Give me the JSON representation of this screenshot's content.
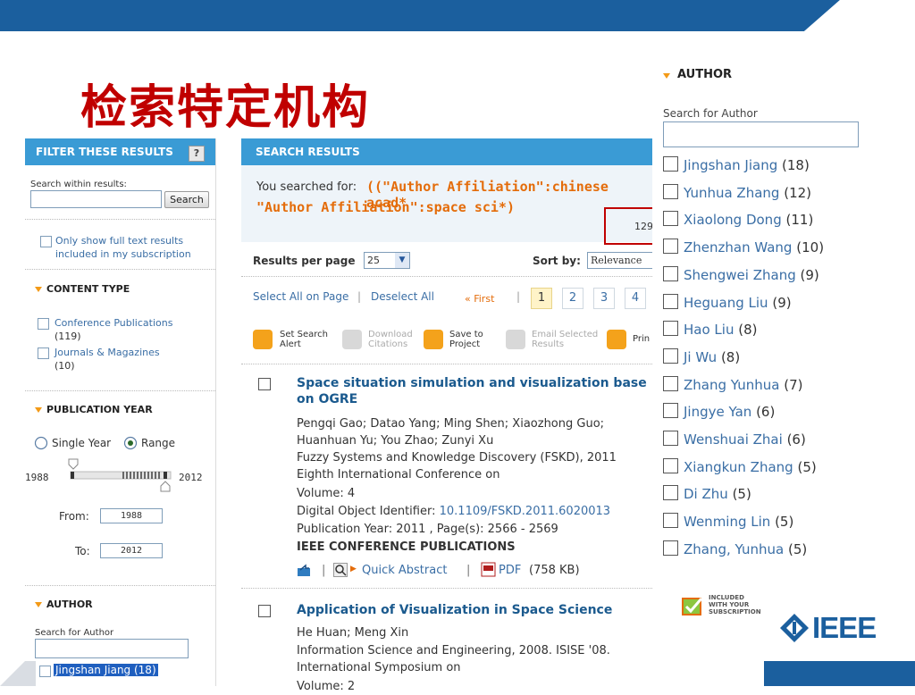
{
  "slide_title": "检索特定机构",
  "colors": {
    "accent_blue": "#1b5f9e",
    "header_blue": "#3a9bd5",
    "title_red": "#c00000",
    "orange": "#e46c0a"
  },
  "filter_panel": {
    "header": "FILTER THESE RESULTS",
    "help_label": "?",
    "search_within_label": "Search within results:",
    "search_button": "Search",
    "full_text_label_1": "Only show full text results",
    "full_text_label_2": "included in my subscription",
    "content_type_title": "CONTENT TYPE",
    "content_types": [
      {
        "label": "Conference Publications",
        "count": "(119)"
      },
      {
        "label": "Journals & Magazines",
        "count": "(10)"
      }
    ],
    "pub_year_title": "PUBLICATION YEAR",
    "single_year_label": "Single Year",
    "range_label": "Range",
    "year_min": "1988",
    "year_max": "2012",
    "from_label": "From:",
    "from_value": "1988",
    "to_label": "To:",
    "to_value": "2012",
    "author_title": "AUTHOR",
    "search_author_label": "Search for Author",
    "first_author": "Jingshan Jiang (18)"
  },
  "results": {
    "header": "SEARCH RESULTS",
    "searched_for_label": "You searched for:",
    "query_line1": "((\"Author Affiliation\":chinese acad*",
    "query_line2": "\"Author Affiliation\":space sci*)",
    "count_partial": "129",
    "per_page_label": "Results per page",
    "per_page_value": "25",
    "sort_label": "Sort by:",
    "sort_value": "Relevance",
    "select_all": "Select All on Page",
    "deselect_all": "Deselect All",
    "first": "« First",
    "pages": [
      "1",
      "2",
      "3",
      "4"
    ],
    "toolbar": {
      "set_alert_1": "Set Search",
      "set_alert_2": "Alert",
      "download_1": "Download",
      "download_2": "Citations",
      "save_1": "Save to",
      "save_2": "Project",
      "email_1": "Email Selected",
      "email_2": "Results",
      "print": "Prin"
    },
    "items": [
      {
        "title_1": "Space situation simulation and visualization base",
        "title_2": "on OGRE",
        "authors_1": "Pengqi Gao; Datao Yang; Ming Shen; Xiaozhong Guo;",
        "authors_2": "Huanhuan Yu; You Zhao; Zunyi Xu",
        "venue_1": "Fuzzy Systems and Knowledge Discovery (FSKD), 2011",
        "venue_2": "Eighth International Conference on",
        "volume": "Volume: 4",
        "doi_label": "Digital Object Identifier:",
        "doi": "10.1109/FSKD.2011.6020013",
        "pubyear": "Publication Year: 2011 , Page(s): 2566 - 2569",
        "publisher": "IEEE CONFERENCE PUBLICATIONS",
        "quick_abstract": "Quick Abstract",
        "pdf_label": "PDF",
        "pdf_size": "(758  KB)"
      },
      {
        "title_1": "Application of Visualization in Space Science",
        "authors_1": "He Huan; Meng Xin",
        "venue_1": "Information Science and Engineering, 2008. ISISE '08.",
        "venue_2": "International Symposium on",
        "volume": "Volume: 2"
      }
    ]
  },
  "author_panel": {
    "title": "AUTHOR",
    "search_label": "Search for Author",
    "authors": [
      {
        "name": "Jingshan Jiang",
        "count": "(18)"
      },
      {
        "name": "Yunhua Zhang",
        "count": "(12)"
      },
      {
        "name": "Xiaolong Dong",
        "count": "(11)"
      },
      {
        "name": "Zhenzhan Wang",
        "count": "(10)"
      },
      {
        "name": "Shengwei Zhang",
        "count": "(9)"
      },
      {
        "name": "Heguang Liu",
        "count": "(9)"
      },
      {
        "name": "Hao Liu",
        "count": "(8)"
      },
      {
        "name": "Ji Wu",
        "count": "(8)"
      },
      {
        "name": "Zhang Yunhua",
        "count": "(7)"
      },
      {
        "name": "Jingye Yan",
        "count": "(6)"
      },
      {
        "name": "Wenshuai Zhai",
        "count": "(6)"
      },
      {
        "name": "Xiangkun Zhang",
        "count": "(5)"
      },
      {
        "name": "Di Zhu",
        "count": "(5)"
      },
      {
        "name": "Wenming Lin",
        "count": "(5)"
      },
      {
        "name": "Zhang, Yunhua",
        "count": "(5)"
      }
    ]
  },
  "subscription_badge": [
    "INCLUDED",
    "WITH YOUR",
    "SUBSCRIPTION"
  ],
  "ieee_logo_text": "IEEE"
}
